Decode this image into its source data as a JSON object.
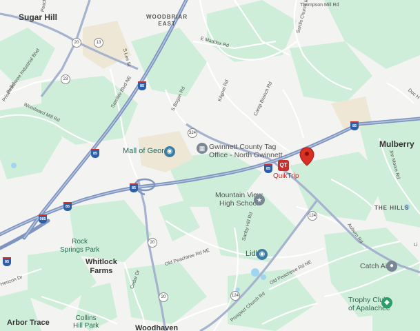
{
  "map": {
    "labels": {
      "sugar_hill": "Sugar Hill",
      "woodbriar_east": "WOODBRIAR\nEAST",
      "mulberry": "Mulberry",
      "the_hills": "THE HILLS",
      "whitlock_farms": "Whitlock\nFarms",
      "arbor_trace": "Arbor Trace",
      "woodhaven": "Woodhaven",
      "rock_springs_park": "Rock\nSprings Park",
      "collins_hill_park": "Collins\nHill Park"
    },
    "pois": {
      "mall_of_georgia": "Mall of Georgia",
      "gwinnett_tag_office": "Gwinnett County Tag\nOffice - North Gwinnett",
      "quiktrip": "QuikTrip",
      "mountain_view_hs": "Mountain View\nHigh School",
      "lidl": "Lidl",
      "catch_air": "Catch Air",
      "trophy_club": "Trophy Club\nof Apalachee"
    },
    "streets": {
      "thompson_mill": "Thompson Mill Rd",
      "e_maddox": "E Maddox Rd",
      "sardis_church": "Sardis Church Rd",
      "kilgore": "Kilgore Rd",
      "camp_branch": "Camp Branch Rd",
      "s_bogan": "S Bogan Rd",
      "sautee_blvd": "Satellite Blvd NE",
      "woodward_mill": "Woodward Mill Rd",
      "peachtree_industrial": "Peachtree Industrial Blvd",
      "old_peachtree_w": "Old Peachtree Rd NE",
      "old_peachtree_e": "Old Peachtree Rd NE",
      "prospect_church": "Prospect Church Rd",
      "auburn": "Auburn Rd",
      "sanby_hill": "Sanby Hill Rd",
      "jim_moore": "Jim Moore Rd",
      "doc_hughes": "Doc H",
      "cedar_dr": "Cedar Dr",
      "horizon_dr": "Horizon Dr",
      "s_lee_st": "S Lee St",
      "peach": "Peach",
      "prison_rd": "Prison Rd",
      "li": "Li"
    },
    "shields": {
      "i85_a": "85",
      "i85_b": "85",
      "i85_c": "85",
      "i85_d": "85",
      "i85_e": "85",
      "i985": "985",
      "r20_a": "20",
      "r20_b": "20",
      "r20_c": "20",
      "r20_d": "20",
      "r13": "13",
      "r23": "23",
      "r324_a": "324",
      "r124_a": "124",
      "r124_b": "124"
    },
    "colors": {
      "background": "#f3f3f1",
      "park": "#c6ecd3",
      "highway": "#7a8fb5",
      "pin": "#d93025",
      "poi_green": "#2a9d6a",
      "poi_blue": "#3b7ea1"
    }
  }
}
